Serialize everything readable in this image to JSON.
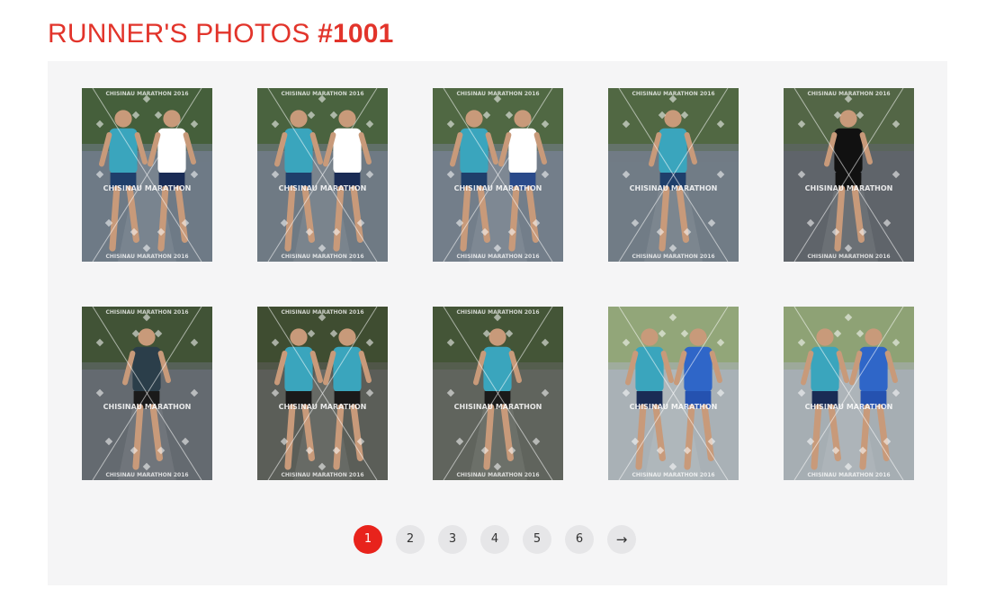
{
  "header": {
    "title_prefix": "RUNNER'S PHOTOS ",
    "runner_number": "#1001"
  },
  "photos": [
    {
      "id": 1,
      "tone": "#6e7a86",
      "foliage": "#3e5a2e",
      "watermark_top": "CHISINAU MARATHON 2016",
      "watermark_bottom": "CHISINAU MARATHON 2016",
      "watermark_center": "CHISINAU MARATHON",
      "runners": [
        {
          "shirt": "#3aa5bd",
          "shorts": "#1f3f6b"
        },
        {
          "shirt": "#ffffff",
          "shorts": "#1a2c55"
        }
      ]
    },
    {
      "id": 2,
      "tone": "#6f7a84",
      "foliage": "#445f32",
      "watermark_top": "CHISINAU MARATHON 2016",
      "watermark_bottom": "CHISINAU MARATHON 2016",
      "watermark_center": "CHISINAU MARATHON",
      "runners": [
        {
          "shirt": "#3aa5bd",
          "shorts": "#1f3f6b"
        },
        {
          "shirt": "#ffffff",
          "shorts": "#1a2c55"
        }
      ]
    },
    {
      "id": 3,
      "tone": "#737e8a",
      "foliage": "#4a6436",
      "watermark_top": "CHISINAU MARATHON 2016",
      "watermark_bottom": "CHISINAU MARATHON 2016",
      "watermark_center": "CHISINAU MARATHON",
      "runners": [
        {
          "shirt": "#3aa5bd",
          "shorts": "#1f3f6b"
        },
        {
          "shirt": "#ffffff",
          "shorts": "#2a4a8a"
        }
      ]
    },
    {
      "id": 4,
      "tone": "#717c86",
      "foliage": "#4b6537",
      "watermark_top": "CHISINAU MARATHON 2016",
      "watermark_bottom": "CHISINAU MARATHON 2016",
      "watermark_center": "CHISINAU MARATHON",
      "runners": [
        {
          "shirt": "#3aa5bd",
          "shorts": "#1f3f6b"
        }
      ]
    },
    {
      "id": 5,
      "tone": "#5f646a",
      "foliage": "#51663f",
      "watermark_top": "CHISINAU MARATHON 2016",
      "watermark_bottom": "CHISINAU MARATHON 2016",
      "watermark_center": "CHISINAU MARATHON",
      "runners": [
        {
          "shirt": "#111111",
          "shorts": "#111111"
        }
      ]
    },
    {
      "id": 6,
      "tone": "#646a70",
      "foliage": "#3b4f2b",
      "watermark_top": "CHISINAU MARATHON 2016",
      "watermark_bottom": "CHISINAU MARATHON 2016",
      "watermark_center": "CHISINAU MARATHON",
      "runners": [
        {
          "shirt": "#2b3e4a",
          "shorts": "#1a1a1a"
        }
      ]
    },
    {
      "id": 7,
      "tone": "#5b5e58",
      "foliage": "#3b4a2a",
      "watermark_top": "CHISINAU MARATHON 2016",
      "watermark_bottom": "CHISINAU MARATHON 2016",
      "watermark_center": "CHISINAU MARATHON",
      "runners": [
        {
          "shirt": "#3aa5bd",
          "shorts": "#1a1a1a"
        },
        {
          "shirt": "#3aa5bd",
          "shorts": "#1a1a1a"
        }
      ]
    },
    {
      "id": 8,
      "tone": "#60645d",
      "foliage": "#3f5230",
      "watermark_top": "CHISINAU MARATHON 2016",
      "watermark_bottom": "CHISINAU MARATHON 2016",
      "watermark_center": "CHISINAU MARATHON",
      "runners": [
        {
          "shirt": "#3aa5bd",
          "shorts": "#1a1a1a"
        }
      ]
    },
    {
      "id": 9,
      "tone": "#a9b1b6",
      "foliage": "#8ea46e",
      "watermark_top": "",
      "watermark_bottom": "CHISINAU MARATHON 2016",
      "watermark_center": "CHISINAU MARATHON",
      "runners": [
        {
          "shirt": "#3aa5bd",
          "shorts": "#1a2c55"
        },
        {
          "shirt": "#2f66c8",
          "shorts": "#2552b0"
        }
      ]
    },
    {
      "id": 10,
      "tone": "#a6aeb3",
      "foliage": "#8aa06a",
      "watermark_top": "",
      "watermark_bottom": "CHISINAU MARATHON 2016",
      "watermark_center": "CHISINAU MARATHON",
      "runners": [
        {
          "shirt": "#3aa5bd",
          "shorts": "#1a2c55"
        },
        {
          "shirt": "#2f66c8",
          "shorts": "#2552b0"
        }
      ]
    }
  ],
  "pagination": {
    "pages": [
      "1",
      "2",
      "3",
      "4",
      "5",
      "6"
    ],
    "current": "1",
    "next_label": "→",
    "active_color": "#e8231c"
  }
}
